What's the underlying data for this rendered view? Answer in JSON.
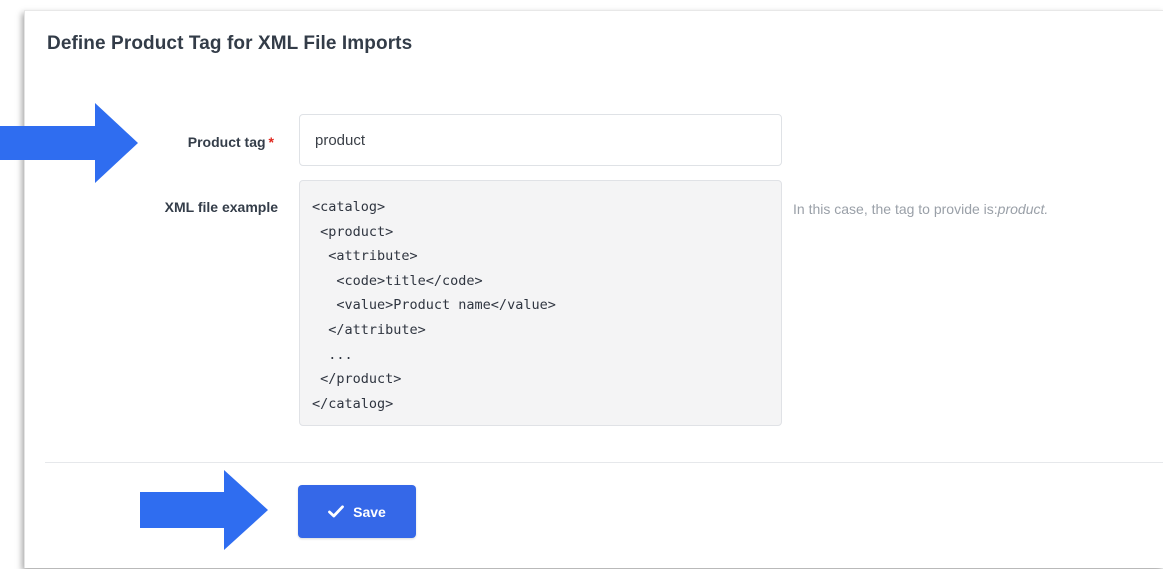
{
  "form": {
    "title": "Define Product Tag for XML File Imports",
    "product_tag": {
      "label": "Product tag",
      "required_marker": "*",
      "value": "product"
    },
    "xml_example": {
      "label": "XML file example",
      "code": "<catalog>\n <product>\n  <attribute>\n   <code>title</code>\n   <value>Product name</value>\n  </attribute>\n  ...\n </product>\n</catalog>",
      "hint_prefix": "In this case, the tag to provide is:",
      "hint_emphasis": "product."
    },
    "save_button": {
      "label": "Save",
      "icon": "checkmark-icon"
    }
  },
  "annotations": {
    "arrow_color": "#2f6df0",
    "arrows": [
      "arrow-right-icon",
      "arrow-right-icon"
    ]
  },
  "colors": {
    "primary_button": "#3568e8",
    "required": "#e0261d"
  }
}
